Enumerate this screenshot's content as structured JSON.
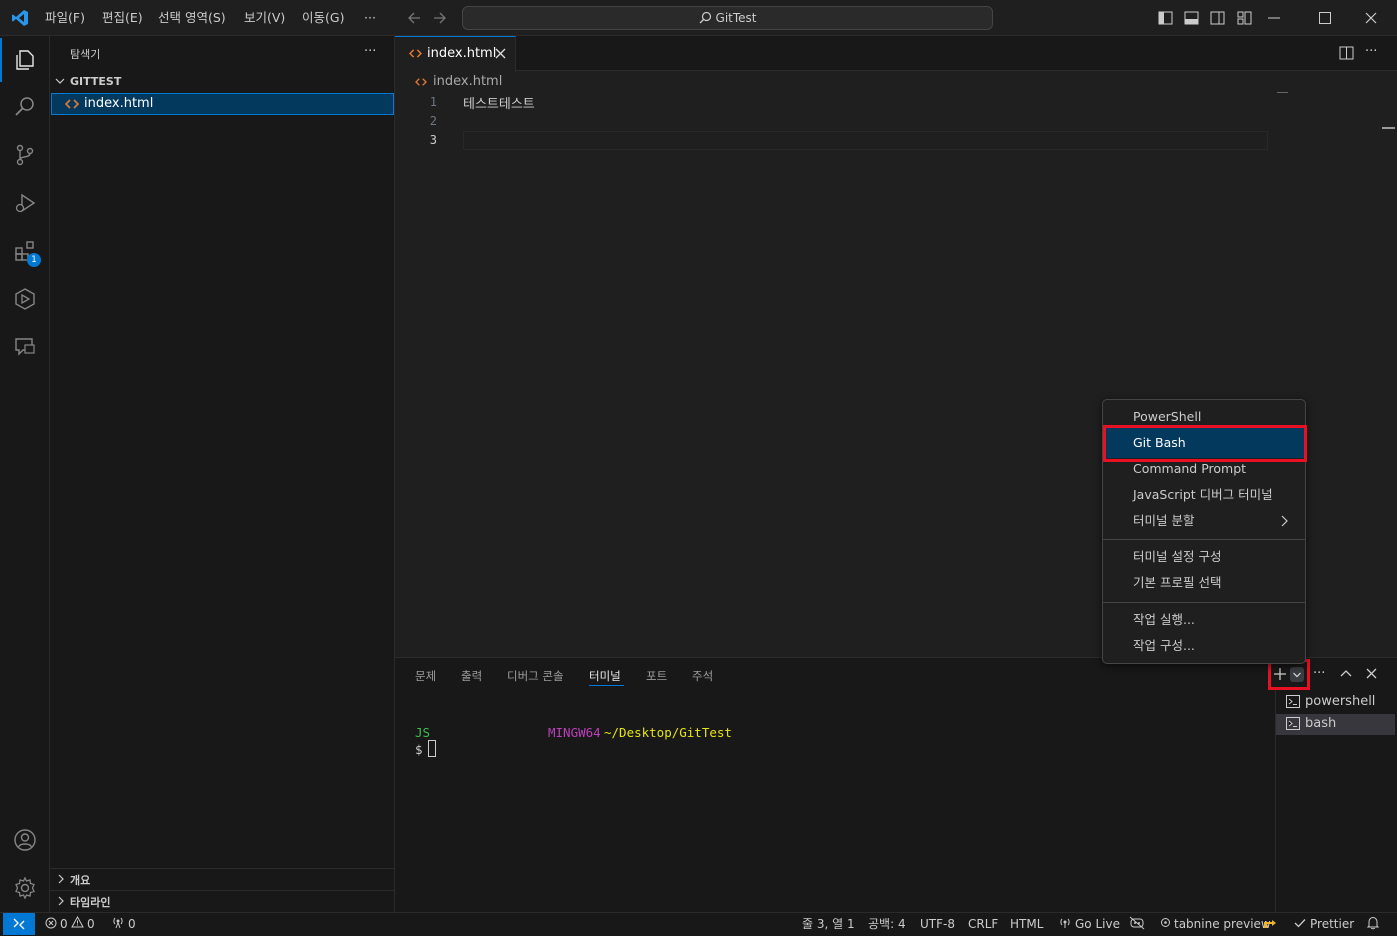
{
  "titlebar": {
    "menus": [
      "파일(F)",
      "편집(E)",
      "선택 영역(S)",
      "보기(V)",
      "이동(G)",
      "···"
    ],
    "search_text": "GitTest"
  },
  "activity": {
    "extensions_badge": "1"
  },
  "sidebar": {
    "title": "탐색기",
    "more": "···",
    "folder": "GITTEST",
    "file": "index.html",
    "outline": "개요",
    "timeline": "타임라인"
  },
  "editor": {
    "tab_label": "index.html",
    "breadcrumb": "index.html",
    "line_numbers": [
      "1",
      "2",
      "3"
    ],
    "lines": [
      "테스트테스트",
      "",
      ""
    ]
  },
  "panel": {
    "tabs": [
      "문제",
      "출력",
      "디버그 콘솔",
      "터미널",
      "포트",
      "주석"
    ],
    "active_tab": "터미널",
    "terminal": {
      "user": "JS",
      "host": "MINGW64",
      "path": "~/Desktop/GitTest",
      "prompt": "$"
    },
    "terminals": [
      "powershell",
      "bash"
    ]
  },
  "dropdown": {
    "items": [
      "PowerShell",
      "Git Bash",
      "Command Prompt",
      "JavaScript 디버그 터미널",
      "터미널 분할",
      "터미널 설정 구성",
      "기본 프로필 선택",
      "작업 실행...",
      "작업 구성..."
    ],
    "highlighted": "Git Bash"
  },
  "statusbar": {
    "errors": "0",
    "warnings": "0",
    "ports": "0",
    "cursor": "줄 3, 열 1",
    "indent": "공백: 4",
    "encoding": "UTF-8",
    "eol": "CRLF",
    "language": "HTML",
    "golive": "Go Live",
    "tabnine": "tabnine preview",
    "prettier": "Prettier"
  },
  "colors": {
    "accent": "#0078d4",
    "highlight_box": "#e81123",
    "selected_item": "#04395e",
    "terminal_green": "#3fb950",
    "terminal_magenta": "#bc3fbc",
    "terminal_yellow": "#e5e510",
    "html_icon": "#e37933"
  }
}
